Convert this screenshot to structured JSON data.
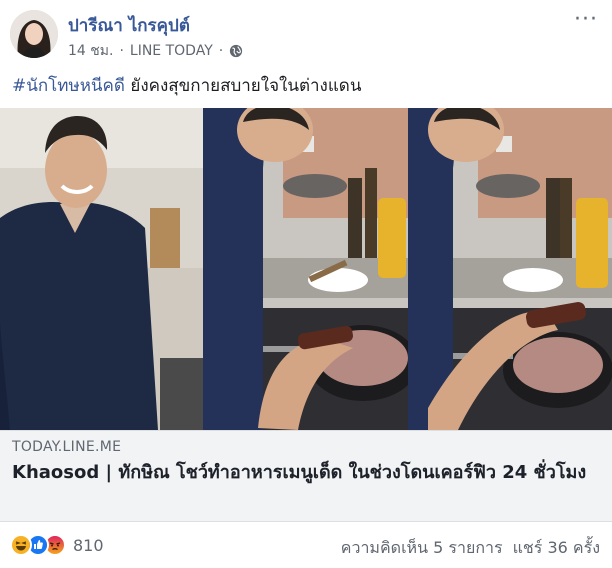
{
  "post": {
    "author": "ปารีณา ไกรคุปต์",
    "time": "14 ชม.",
    "separator": "·",
    "source": "LINE TODAY",
    "separator2": "·",
    "hashtag": "#นักโทษหนีคดี",
    "text": " ยังคงสุขกายสบายใจในต่างแดน",
    "more_label": "···"
  },
  "link": {
    "domain": "TODAY.LINE.ME",
    "title": "Khaosod | ทักษิณ โชว์ทำอาหารเมนูเด็ด ในช่วงโดนเคอร์ฟิว 24 ชั่วโมง"
  },
  "footer": {
    "reaction_icons": [
      "haha-icon",
      "like-icon",
      "angry-icon"
    ],
    "reaction_count": "810",
    "comments": "ความคิดเห็น 5 รายการ",
    "shares": "แชร์ 36 ครั้ง"
  },
  "colors": {
    "link_blue": "#385898",
    "meta_gray": "#606770",
    "link_bg": "#f2f3f5",
    "like_blue": "#1877f2",
    "haha_yellow": "#f7b125",
    "angry_orange": "#e9710f"
  }
}
